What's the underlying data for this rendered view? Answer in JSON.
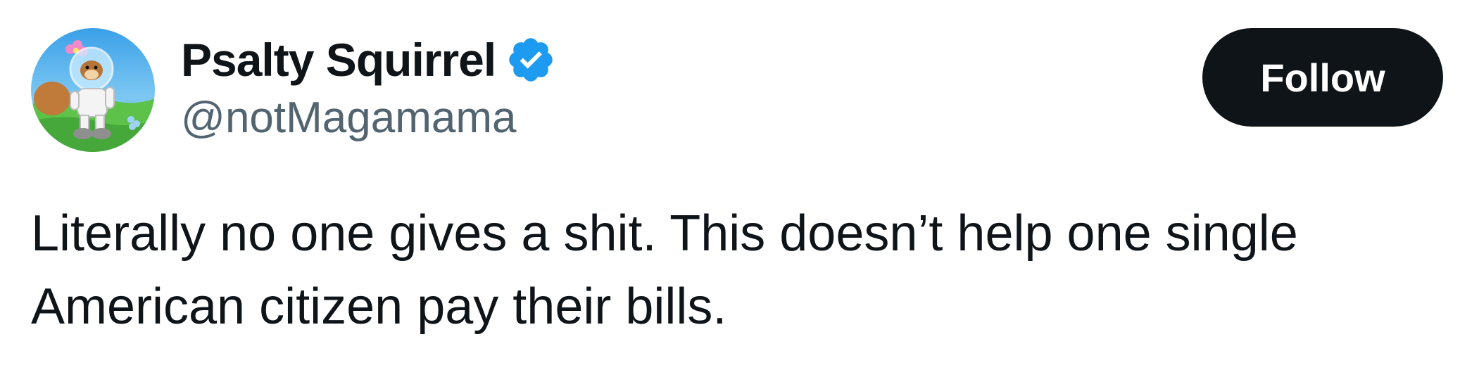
{
  "author": {
    "display_name": "Psalty Squirrel",
    "handle": "@notMagamama",
    "verified": true
  },
  "follow_button": {
    "label": "Follow"
  },
  "tweet": {
    "text_lines": [
      "Literally no one gives a shit. This doesn’t help one single",
      "American citizen pay their bills."
    ]
  },
  "colors": {
    "text_primary": "#0f1419",
    "text_secondary": "#536471",
    "verified_blue": "#1d9bf0",
    "button_bg": "#0f1419",
    "button_text": "#ffffff"
  },
  "icons": {
    "verified": "verified-badge-icon"
  }
}
